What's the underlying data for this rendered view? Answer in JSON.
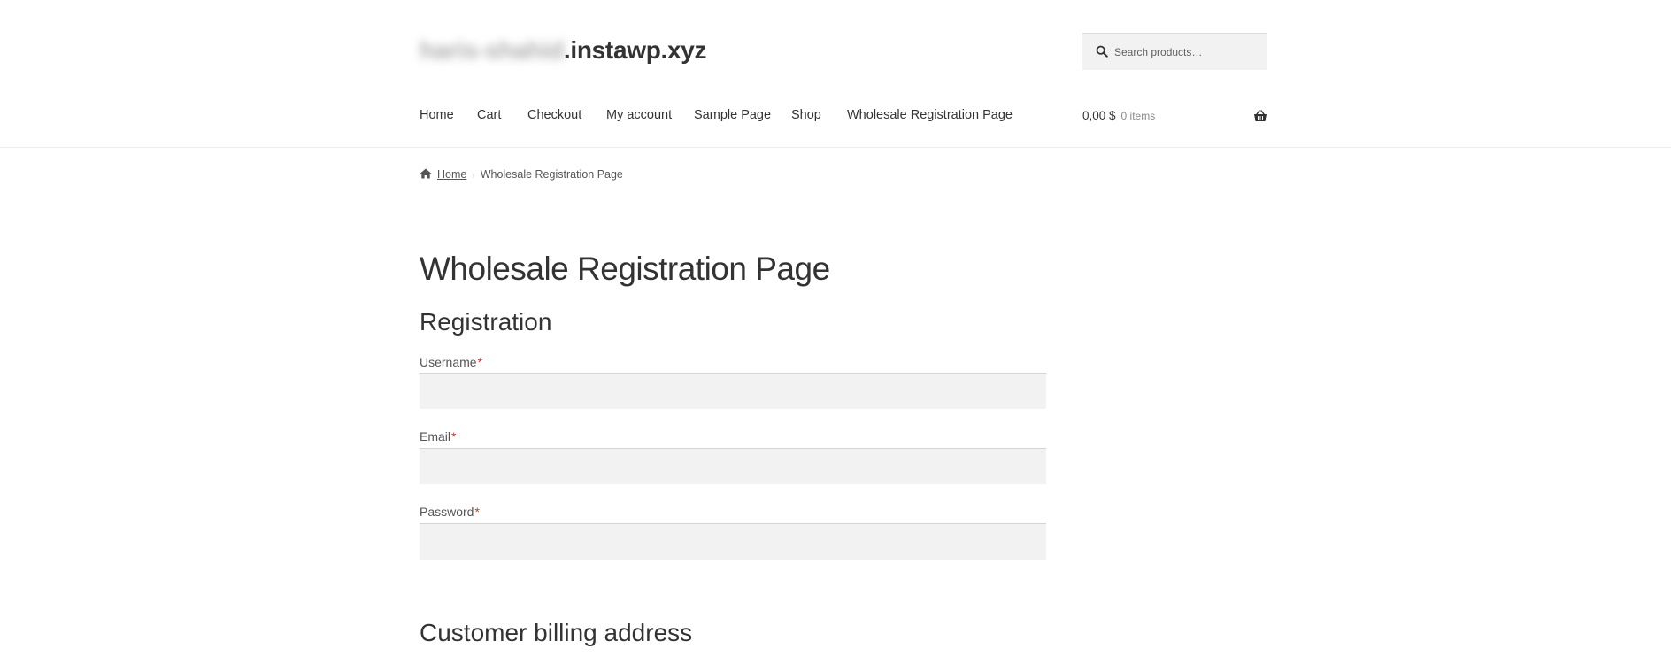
{
  "site": {
    "title_blurred": "haris-shahid",
    "title_domain": ".instawp.xyz"
  },
  "search": {
    "placeholder": "Search products…",
    "icon": "search-icon"
  },
  "nav": {
    "items": [
      {
        "label": "Home"
      },
      {
        "label": "Cart"
      },
      {
        "label": "Checkout"
      },
      {
        "label": "My account"
      },
      {
        "label": "Sample Page"
      },
      {
        "label": "Shop"
      },
      {
        "label": "Wholesale Registration Page"
      }
    ]
  },
  "cart": {
    "amount": "0,00 $",
    "count": "0 items",
    "icon": "basket-icon"
  },
  "breadcrumb": {
    "home": "Home",
    "current": "Wholesale Registration Page"
  },
  "content": {
    "page_title": "Wholesale Registration Page",
    "section_registration": "Registration",
    "section_billing": "Customer billing address",
    "fields": [
      {
        "label": "Username",
        "required_mark": "*",
        "value": ""
      },
      {
        "label": "Email",
        "required_mark": "*",
        "value": ""
      },
      {
        "label": "Password",
        "required_mark": "*",
        "value": ""
      }
    ]
  },
  "colors": {
    "text": "#333333",
    "input_bg": "#f2f2f2",
    "required": "#c0392b"
  }
}
